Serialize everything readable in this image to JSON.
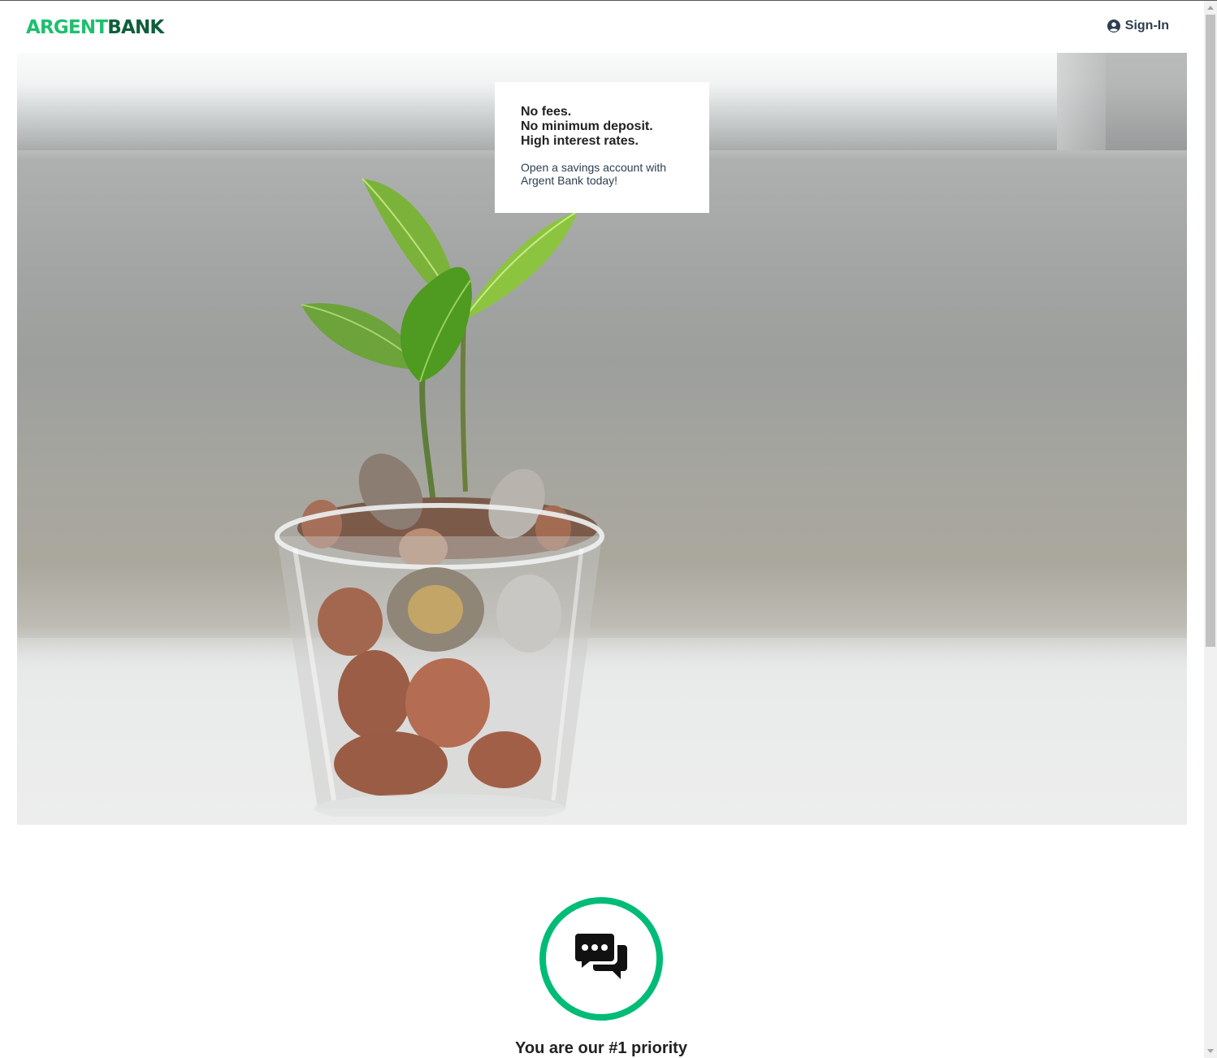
{
  "header": {
    "logo": {
      "part1": "ARGENT",
      "part2": "BANK",
      "alt": "Argent Bank Logo"
    },
    "signin_label": "Sign-In"
  },
  "hero": {
    "subtitles": [
      "No fees.",
      "No minimum deposit.",
      "High interest rates."
    ],
    "text": "Open a savings account with Argent Bank today!"
  },
  "features": [
    {
      "icon": "chat-icon",
      "title": "You are our #1 priority"
    }
  ],
  "colors": {
    "brand_green": "#00bc77",
    "logo_light_green": "#1ebf6e",
    "logo_dark_green": "#0f5e3a",
    "text_dark": "#2c3e50"
  }
}
